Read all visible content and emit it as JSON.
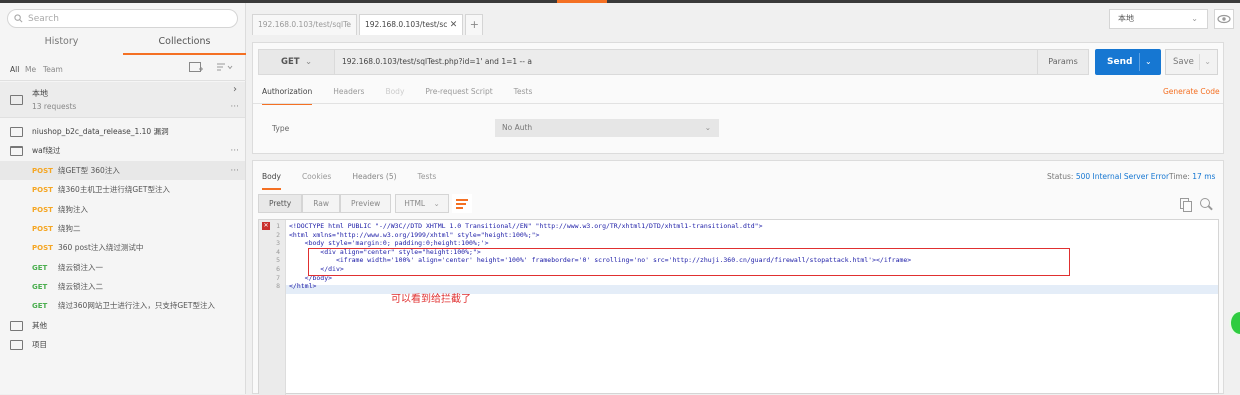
{
  "sidebar": {
    "search_placeholder": "Search",
    "tabs": [
      "History",
      "Collections"
    ],
    "filters": [
      "All",
      "Me",
      "Team"
    ],
    "collection_main": {
      "name": "本地",
      "count": "13 requests"
    },
    "folders": [
      {
        "name": "niushop_b2c_data_release_1.10 漏洞"
      },
      {
        "name": "waf绕过"
      }
    ],
    "requests": [
      {
        "method": "POST",
        "name": "绕GET型 360注入"
      },
      {
        "method": "POST",
        "name": "绕360主机卫士进行绕GET型注入"
      },
      {
        "method": "POST",
        "name": "绕狗注入"
      },
      {
        "method": "POST",
        "name": "绕狗二"
      },
      {
        "method": "POST",
        "name": "360 post注入绕过测试中"
      },
      {
        "method": "GET",
        "name": "绕云锁注入一"
      },
      {
        "method": "GET",
        "name": "绕云锁注入二"
      },
      {
        "method": "GET",
        "name": "绕过360网站卫士进行注入，只支持GET型注入"
      }
    ],
    "bottom_folders": [
      "其他",
      "项目"
    ]
  },
  "request_tabs": [
    "192.168.0.103/test/sqlTe",
    "192.168.0.103/test/sc"
  ],
  "environment": "本地",
  "request": {
    "method": "GET",
    "url": "192.168.0.103/test/sqlTest.php?id=1' and 1=1 -- a",
    "params_label": "Params",
    "send_label": "Send",
    "save_label": "Save",
    "tabs": [
      "Authorization",
      "Headers",
      "Body",
      "Pre-request Script",
      "Tests"
    ],
    "generate_code": "Generate Code",
    "type_label": "Type",
    "auth_type": "No Auth"
  },
  "response": {
    "tabs": [
      "Body",
      "Cookies",
      "Headers (5)",
      "Tests"
    ],
    "status_label": "Status:",
    "status_value": "500 Internal Server Error",
    "time_label": "Time:",
    "time_value": "17 ms",
    "view_modes": [
      "Pretty",
      "Raw",
      "Preview"
    ],
    "format": "HTML",
    "code_lines": [
      "<!DOCTYPE html PUBLIC \"-//W3C//DTD XHTML 1.0 Transitional//EN\" \"http://www.w3.org/TR/xhtml1/DTD/xhtml1-transitional.dtd\">",
      "<html xmlns=\"http://www.w3.org/1999/xhtml\" style=\"height:100%;\">",
      "    <body style='margin:0; padding:0;height:100%;'>",
      "        <div align=\"center\" style=\"height:100%;\">",
      "            <iframe width='100%' align='center' height='100%' frameborder='0' scrolling='no' src='http://zhuji.360.cn/guard/firewall/stopattack.html'></iframe>",
      "        </div>",
      "    </body>",
      "</html>"
    ],
    "line_numbers": [
      "1",
      "2",
      "3",
      "4",
      "5",
      "6",
      "7",
      "8"
    ],
    "annotation": "可以看到给拦截了"
  },
  "colors": {
    "accent": "#f47023",
    "send": "#1677d2",
    "post": "#f5a623",
    "get": "#4caf50",
    "annotation": "#e03030"
  }
}
